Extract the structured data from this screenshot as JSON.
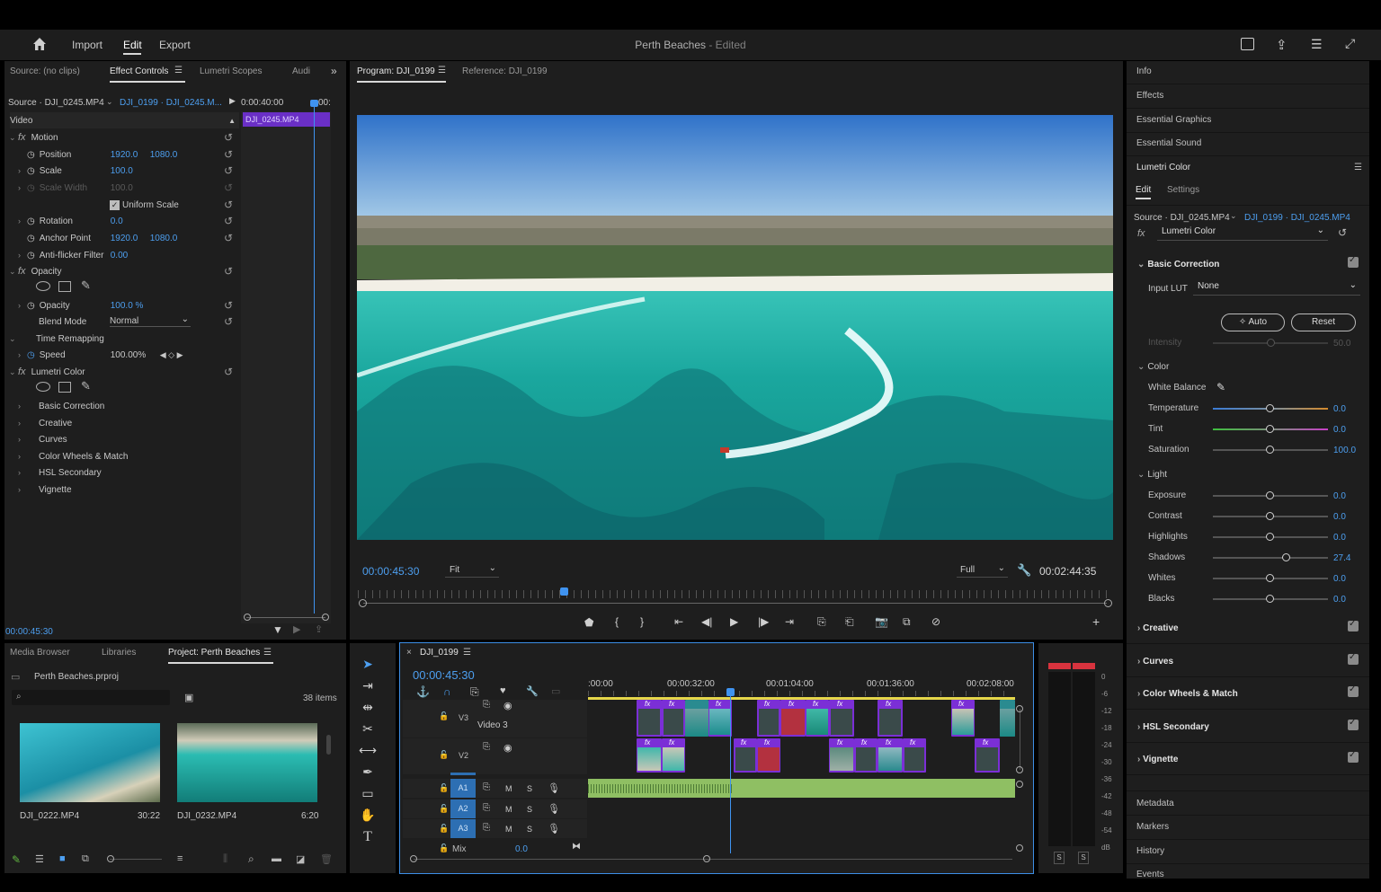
{
  "header": {
    "nav": [
      "Import",
      "Edit",
      "Export"
    ],
    "title": "Perth Beaches",
    "title_suffix": " - Edited"
  },
  "source_panel": {
    "tabs": [
      "Source: (no clips)",
      "Effect Controls",
      "Lumetri Scopes",
      "Audi"
    ],
    "source_clip": "Source · DJI_0245.MP4",
    "seq_clip": "DJI_0199 · DJI_0245.M...",
    "time_ruler": "0:00:40:00",
    "time_end": "00:",
    "clip_bar": "DJI_0245.MP4",
    "section_video": "Video",
    "motion": "Motion",
    "position_label": "Position",
    "position_x": "1920.0",
    "position_y": "1080.0",
    "scale_label": "Scale",
    "scale_val": "100.0",
    "scale_width_label": "Scale Width",
    "scale_width_val": "100.0",
    "uniform_scale": "Uniform Scale",
    "rotation_label": "Rotation",
    "rotation_val": "0.0",
    "anchor_label": "Anchor Point",
    "anchor_x": "1920.0",
    "anchor_y": "1080.0",
    "antiflicker_label": "Anti-flicker Filter",
    "antiflicker_val": "0.00",
    "opacity_group": "Opacity",
    "opacity_label": "Opacity",
    "opacity_val": "100.0 %",
    "blend_label": "Blend Mode",
    "blend_val": "Normal",
    "time_remap": "Time Remapping",
    "speed_label": "Speed",
    "speed_val": "100.00%",
    "lumetri": "Lumetri Color",
    "lumetri_items": [
      "Basic Correction",
      "Creative",
      "Curves",
      "Color Wheels & Match",
      "HSL Secondary",
      "Vignette"
    ],
    "timecode": "00:00:45:30"
  },
  "program": {
    "tab": "Program: DJI_0199",
    "reference": "Reference: DJI_0199",
    "timecode": "00:00:45:30",
    "fit": "Fit",
    "quality": "Full",
    "duration": "00:02:44:35"
  },
  "project": {
    "tabs": [
      "Media Browser",
      "Libraries",
      "Project: Perth Beaches"
    ],
    "file": "Perth Beaches.prproj",
    "count": "38 items",
    "items": [
      {
        "name": "DJI_0222.MP4",
        "duration": "30:22"
      },
      {
        "name": "DJI_0232.MP4",
        "duration": "6:20"
      }
    ]
  },
  "timeline": {
    "tab": "DJI_0199",
    "timecode": "00:00:45:30",
    "ruler": [
      ":00:00",
      "00:00:32:00",
      "00:01:04:00",
      "00:01:36:00",
      "00:02:08:00"
    ],
    "tracks_video": [
      {
        "id": "V3",
        "name": "Video 3"
      },
      {
        "id": "V2",
        "name": ""
      }
    ],
    "tracks_audio": [
      "A1",
      "A2",
      "A3"
    ],
    "mute": "M",
    "solo": "S",
    "mix_label": "Mix",
    "mix_val": "0.0",
    "fx": "fx"
  },
  "meter": {
    "scale": [
      "0",
      "-6",
      "-12",
      "-18",
      "-24",
      "-30",
      "-36",
      "-42",
      "-48",
      "-54",
      "dB"
    ],
    "solo": "S"
  },
  "right_panel": {
    "links_top": [
      "Info",
      "Effects",
      "Essential Graphics",
      "Essential Sound"
    ],
    "lumetri_title": "Lumetri Color",
    "tabs": [
      "Edit",
      "Settings"
    ],
    "source": "Source · DJI_0245.MP4",
    "seq": "DJI_0199 · DJI_0245.MP4",
    "fx_select": "Lumetri Color",
    "basic_correction": "Basic Correction",
    "input_lut_label": "Input LUT",
    "input_lut_val": "None",
    "auto": "Auto",
    "reset": "Reset",
    "intensity_label": "Intensity",
    "intensity_val": "50.0",
    "color": "Color",
    "white_balance": "White Balance",
    "color_sliders": [
      {
        "label": "Temperature",
        "value": "0.0",
        "pos": 0.5
      },
      {
        "label": "Tint",
        "value": "0.0",
        "pos": 0.5
      },
      {
        "label": "Saturation",
        "value": "100.0",
        "pos": 0.5
      }
    ],
    "light": "Light",
    "light_sliders": [
      {
        "label": "Exposure",
        "value": "0.0",
        "pos": 0.5
      },
      {
        "label": "Contrast",
        "value": "0.0",
        "pos": 0.5
      },
      {
        "label": "Highlights",
        "value": "0.0",
        "pos": 0.5
      },
      {
        "label": "Shadows",
        "value": "27.4",
        "pos": 0.64
      },
      {
        "label": "Whites",
        "value": "0.0",
        "pos": 0.5
      },
      {
        "label": "Blacks",
        "value": "0.0",
        "pos": 0.5
      }
    ],
    "sections": [
      "Creative",
      "Curves",
      "Color Wheels & Match",
      "HSL Secondary",
      "Vignette"
    ],
    "links_bottom": [
      "Metadata",
      "Markers",
      "History",
      "Events"
    ]
  },
  "colors": {
    "accent": "#4d9ff0",
    "clip_purple": "#7b2fd6",
    "audio_green": "#8fbf63",
    "timeline_border": "#3d8ee6"
  }
}
